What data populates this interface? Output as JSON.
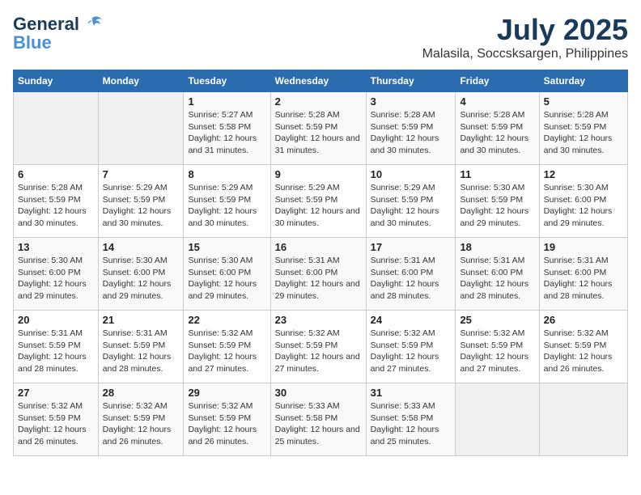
{
  "logo": {
    "line1": "General",
    "line2": "Blue"
  },
  "title": "July 2025",
  "subtitle": "Malasila, Soccsksargen, Philippines",
  "days_of_week": [
    "Sunday",
    "Monday",
    "Tuesday",
    "Wednesday",
    "Thursday",
    "Friday",
    "Saturday"
  ],
  "weeks": [
    [
      {
        "day": "",
        "info": ""
      },
      {
        "day": "",
        "info": ""
      },
      {
        "day": "1",
        "info": "Sunrise: 5:27 AM\nSunset: 5:58 PM\nDaylight: 12 hours and 31 minutes."
      },
      {
        "day": "2",
        "info": "Sunrise: 5:28 AM\nSunset: 5:59 PM\nDaylight: 12 hours and 31 minutes."
      },
      {
        "day": "3",
        "info": "Sunrise: 5:28 AM\nSunset: 5:59 PM\nDaylight: 12 hours and 30 minutes."
      },
      {
        "day": "4",
        "info": "Sunrise: 5:28 AM\nSunset: 5:59 PM\nDaylight: 12 hours and 30 minutes."
      },
      {
        "day": "5",
        "info": "Sunrise: 5:28 AM\nSunset: 5:59 PM\nDaylight: 12 hours and 30 minutes."
      }
    ],
    [
      {
        "day": "6",
        "info": "Sunrise: 5:28 AM\nSunset: 5:59 PM\nDaylight: 12 hours and 30 minutes."
      },
      {
        "day": "7",
        "info": "Sunrise: 5:29 AM\nSunset: 5:59 PM\nDaylight: 12 hours and 30 minutes."
      },
      {
        "day": "8",
        "info": "Sunrise: 5:29 AM\nSunset: 5:59 PM\nDaylight: 12 hours and 30 minutes."
      },
      {
        "day": "9",
        "info": "Sunrise: 5:29 AM\nSunset: 5:59 PM\nDaylight: 12 hours and 30 minutes."
      },
      {
        "day": "10",
        "info": "Sunrise: 5:29 AM\nSunset: 5:59 PM\nDaylight: 12 hours and 30 minutes."
      },
      {
        "day": "11",
        "info": "Sunrise: 5:30 AM\nSunset: 5:59 PM\nDaylight: 12 hours and 29 minutes."
      },
      {
        "day": "12",
        "info": "Sunrise: 5:30 AM\nSunset: 6:00 PM\nDaylight: 12 hours and 29 minutes."
      }
    ],
    [
      {
        "day": "13",
        "info": "Sunrise: 5:30 AM\nSunset: 6:00 PM\nDaylight: 12 hours and 29 minutes."
      },
      {
        "day": "14",
        "info": "Sunrise: 5:30 AM\nSunset: 6:00 PM\nDaylight: 12 hours and 29 minutes."
      },
      {
        "day": "15",
        "info": "Sunrise: 5:30 AM\nSunset: 6:00 PM\nDaylight: 12 hours and 29 minutes."
      },
      {
        "day": "16",
        "info": "Sunrise: 5:31 AM\nSunset: 6:00 PM\nDaylight: 12 hours and 29 minutes."
      },
      {
        "day": "17",
        "info": "Sunrise: 5:31 AM\nSunset: 6:00 PM\nDaylight: 12 hours and 28 minutes."
      },
      {
        "day": "18",
        "info": "Sunrise: 5:31 AM\nSunset: 6:00 PM\nDaylight: 12 hours and 28 minutes."
      },
      {
        "day": "19",
        "info": "Sunrise: 5:31 AM\nSunset: 6:00 PM\nDaylight: 12 hours and 28 minutes."
      }
    ],
    [
      {
        "day": "20",
        "info": "Sunrise: 5:31 AM\nSunset: 5:59 PM\nDaylight: 12 hours and 28 minutes."
      },
      {
        "day": "21",
        "info": "Sunrise: 5:31 AM\nSunset: 5:59 PM\nDaylight: 12 hours and 28 minutes."
      },
      {
        "day": "22",
        "info": "Sunrise: 5:32 AM\nSunset: 5:59 PM\nDaylight: 12 hours and 27 minutes."
      },
      {
        "day": "23",
        "info": "Sunrise: 5:32 AM\nSunset: 5:59 PM\nDaylight: 12 hours and 27 minutes."
      },
      {
        "day": "24",
        "info": "Sunrise: 5:32 AM\nSunset: 5:59 PM\nDaylight: 12 hours and 27 minutes."
      },
      {
        "day": "25",
        "info": "Sunrise: 5:32 AM\nSunset: 5:59 PM\nDaylight: 12 hours and 27 minutes."
      },
      {
        "day": "26",
        "info": "Sunrise: 5:32 AM\nSunset: 5:59 PM\nDaylight: 12 hours and 26 minutes."
      }
    ],
    [
      {
        "day": "27",
        "info": "Sunrise: 5:32 AM\nSunset: 5:59 PM\nDaylight: 12 hours and 26 minutes."
      },
      {
        "day": "28",
        "info": "Sunrise: 5:32 AM\nSunset: 5:59 PM\nDaylight: 12 hours and 26 minutes."
      },
      {
        "day": "29",
        "info": "Sunrise: 5:32 AM\nSunset: 5:59 PM\nDaylight: 12 hours and 26 minutes."
      },
      {
        "day": "30",
        "info": "Sunrise: 5:33 AM\nSunset: 5:58 PM\nDaylight: 12 hours and 25 minutes."
      },
      {
        "day": "31",
        "info": "Sunrise: 5:33 AM\nSunset: 5:58 PM\nDaylight: 12 hours and 25 minutes."
      },
      {
        "day": "",
        "info": ""
      },
      {
        "day": "",
        "info": ""
      }
    ]
  ]
}
